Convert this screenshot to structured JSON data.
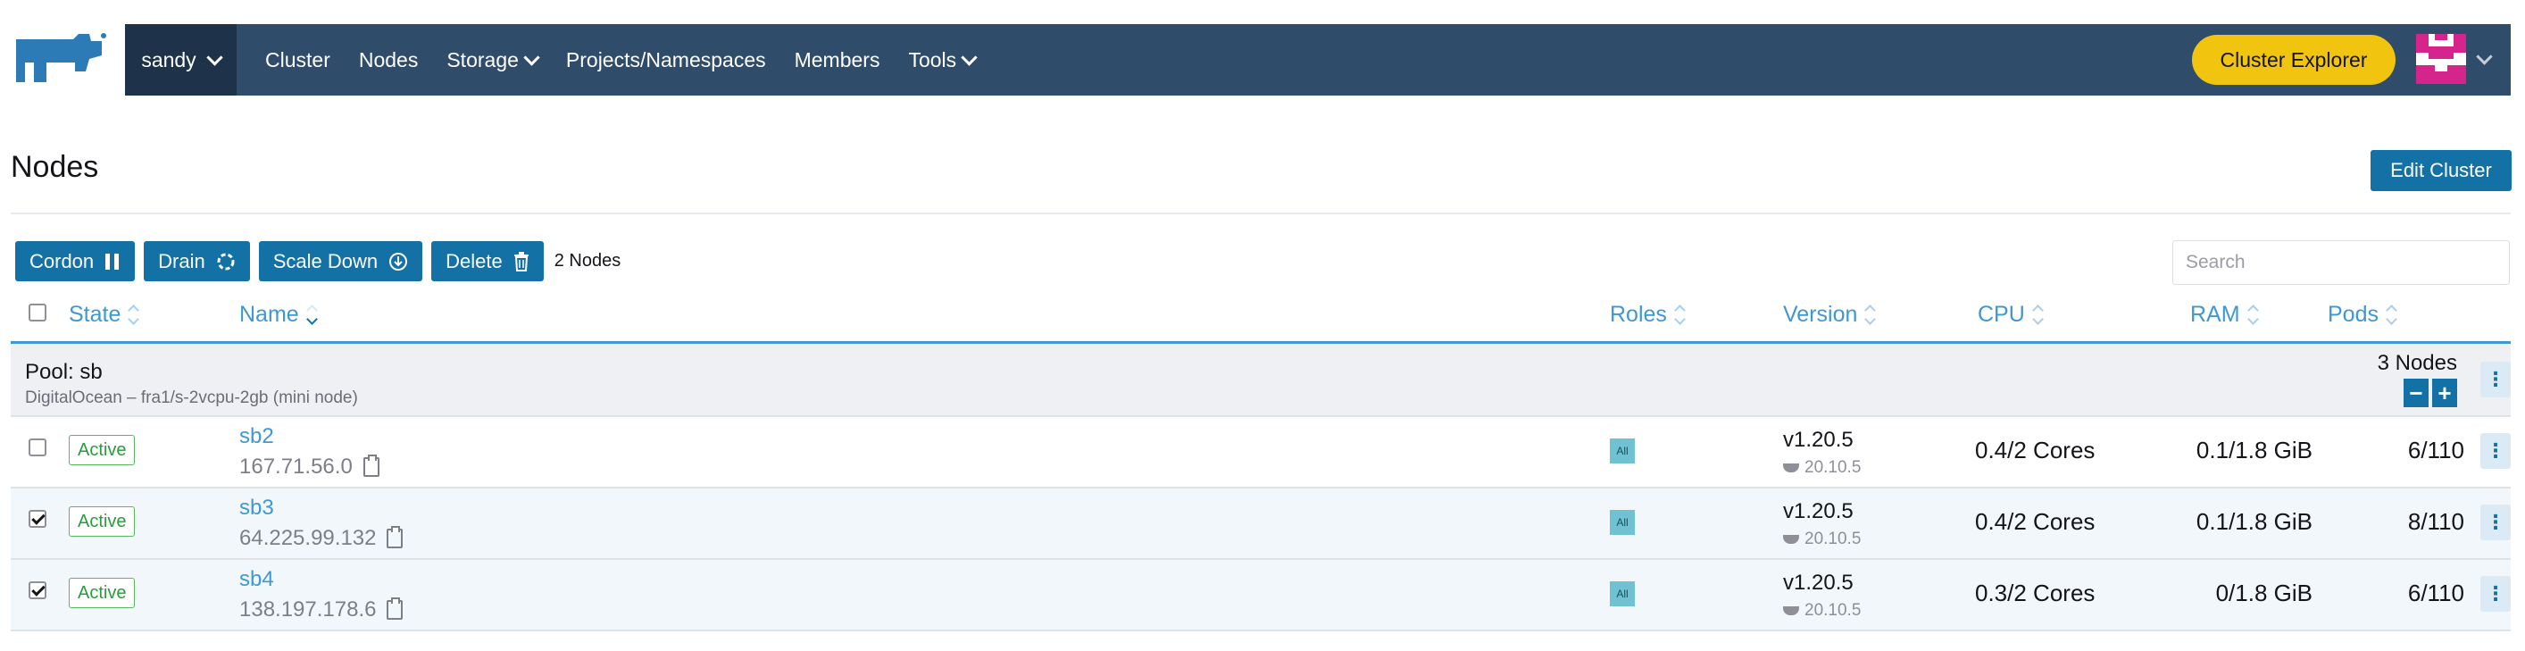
{
  "header": {
    "cluster_name": "sandy",
    "nav": [
      "Cluster",
      "Nodes",
      "Storage",
      "Projects/Namespaces",
      "Members",
      "Tools"
    ],
    "cluster_explorer_label": "Cluster Explorer"
  },
  "page": {
    "title": "Nodes",
    "edit_cluster_label": "Edit Cluster"
  },
  "bulk_actions": {
    "cordon": "Cordon",
    "drain": "Drain",
    "scale_down": "Scale Down",
    "delete": "Delete",
    "selected_count": "2 Nodes"
  },
  "search": {
    "placeholder": "Search",
    "value": ""
  },
  "table": {
    "columns": [
      "State",
      "Name",
      "Roles",
      "Version",
      "CPU",
      "RAM",
      "Pods"
    ],
    "pool": {
      "title": "Pool: sb",
      "subtitle": "DigitalOcean – fra1/s-2vcpu-2gb (mini node)",
      "node_count": "3 Nodes"
    },
    "rows": [
      {
        "state": "Active",
        "name": "sb2",
        "ip": "167.71.56.0",
        "role": "All",
        "version": "v1.20.5",
        "docker": "20.10.5",
        "cpu": "0.4/2 Cores",
        "ram": "0.1/1.8 GiB",
        "pods": "6/110",
        "checked": false
      },
      {
        "state": "Active",
        "name": "sb3",
        "ip": "64.225.99.132",
        "role": "All",
        "version": "v1.20.5",
        "docker": "20.10.5",
        "cpu": "0.4/2 Cores",
        "ram": "0.1/1.8 GiB",
        "pods": "8/110",
        "checked": true
      },
      {
        "state": "Active",
        "name": "sb4",
        "ip": "138.197.178.6",
        "role": "All",
        "version": "v1.20.5",
        "docker": "20.10.5",
        "cpu": "0.3/2 Cores",
        "ram": "0/1.8 GiB",
        "pods": "6/110",
        "checked": true
      }
    ]
  },
  "colors": {
    "topbar": "#2f4c6b",
    "primary": "#1371a5",
    "accent_link": "#3d98d3",
    "explorer_button": "#f1c40f",
    "active_badge": "#5bb75b"
  },
  "icons": {
    "logo": "rancher-cow-logo",
    "cordon": "pause-icon",
    "drain": "drain-icon",
    "scale_down": "download-circle-icon",
    "delete": "trash-icon",
    "copy": "clipboard-icon",
    "docker": "docker-icon",
    "row_actions": "kebab-menu-icon"
  }
}
